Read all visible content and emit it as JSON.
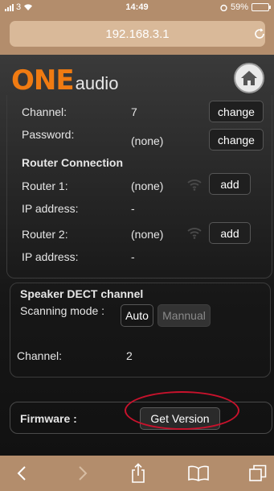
{
  "status_bar": {
    "carrier": "3",
    "time": "14:49",
    "battery": "59%"
  },
  "browser": {
    "url": "192.168.3.1"
  },
  "header": {
    "logo_one": "ONE",
    "logo_audio": "audio"
  },
  "settings": {
    "channel_label": "Channel:",
    "channel_value": "7",
    "change_label": "change",
    "password_label": "Password:",
    "password_value": "(none)",
    "router_section": "Router Connection",
    "router1_label": "Router 1:",
    "router1_value": "(none)",
    "ip_label": "IP address:",
    "ip1_value": "-",
    "router2_label": "Router 2:",
    "router2_value": "(none)",
    "ip2_value": "-",
    "add_label": "add"
  },
  "dect": {
    "title": "Speaker DECT channel",
    "scan_label": "Scanning mode :",
    "auto_label": "Auto",
    "manual_label": "Mannual",
    "channel_label": "Channel:",
    "channel_value": "2"
  },
  "firmware": {
    "label": "Firmware :",
    "button": "Get Version"
  },
  "colors": {
    "brand_orange": "#f07b12",
    "browser_chrome": "#b38d6c",
    "highlight_red": "#c8122c"
  }
}
